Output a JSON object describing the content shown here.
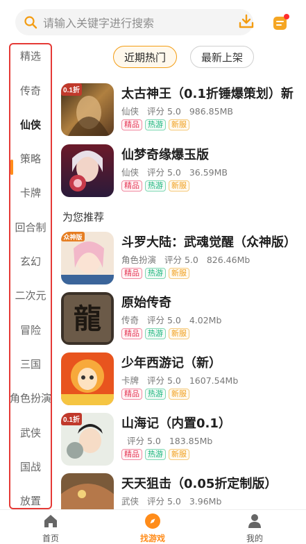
{
  "search": {
    "placeholder": "请输入关键字进行搜索"
  },
  "sidebar": {
    "items": [
      {
        "label": "精选"
      },
      {
        "label": "传奇"
      },
      {
        "label": "仙侠"
      },
      {
        "label": "策略"
      },
      {
        "label": "卡牌"
      },
      {
        "label": "回合制"
      },
      {
        "label": "玄幻"
      },
      {
        "label": "二次元"
      },
      {
        "label": "冒险"
      },
      {
        "label": "三国"
      },
      {
        "label": "角色扮演"
      },
      {
        "label": "武侠"
      },
      {
        "label": "国战"
      },
      {
        "label": "放置"
      }
    ],
    "active_index": 2
  },
  "tabs": [
    {
      "label": "近期热门",
      "active": true
    },
    {
      "label": "最新上架",
      "active": false
    }
  ],
  "section": {
    "recommend_title": "为您推荐"
  },
  "games": [
    {
      "name": "太古神王（0.1折锤爆策划）新",
      "category": "仙侠",
      "rating": "评分 5.0",
      "size": "986.85MB",
      "tags": [
        "精品",
        "热游",
        "新服"
      ],
      "badge": "0.1折"
    },
    {
      "name": "仙梦奇缘爆玉版",
      "category": "仙侠",
      "rating": "评分 5.0",
      "size": "36.59MB",
      "tags": [
        "精品",
        "热游",
        "新服"
      ],
      "badge": ""
    },
    {
      "name": "斗罗大陆：武魂觉醒（众神版）",
      "category": "角色扮演",
      "rating": "评分 5.0",
      "size": "826.46Mb",
      "tags": [
        "精品",
        "热游",
        "新服"
      ],
      "badge": "众神版"
    },
    {
      "name": "原始传奇",
      "category": "传奇",
      "rating": "评分 5.0",
      "size": "4.02Mb",
      "tags": [
        "精品",
        "热游",
        "新服"
      ],
      "badge": "龍"
    },
    {
      "name": "少年西游记（新）",
      "category": "卡牌",
      "rating": "评分 5.0",
      "size": "1607.54Mb",
      "tags": [
        "精品",
        "热游",
        "新服"
      ],
      "badge": ""
    },
    {
      "name": "山海记（内置0.1）",
      "category": "",
      "rating": "评分 5.0",
      "size": "183.85Mb",
      "tags": [
        "精品",
        "热游",
        "新服"
      ],
      "badge": "0.1折"
    },
    {
      "name": "天天狙击（0.05折定制版）",
      "category": "武侠",
      "rating": "评分 5.0",
      "size": "3.96Mb",
      "tags": [],
      "badge": ""
    }
  ],
  "bottom_nav": [
    {
      "label": "首页",
      "icon": "home-icon"
    },
    {
      "label": "找游戏",
      "icon": "compass-icon",
      "active": true
    },
    {
      "label": "我的",
      "icon": "person-icon"
    }
  ],
  "colors": {
    "accent": "#ff8c1a",
    "highlight_border": "#e53935"
  }
}
